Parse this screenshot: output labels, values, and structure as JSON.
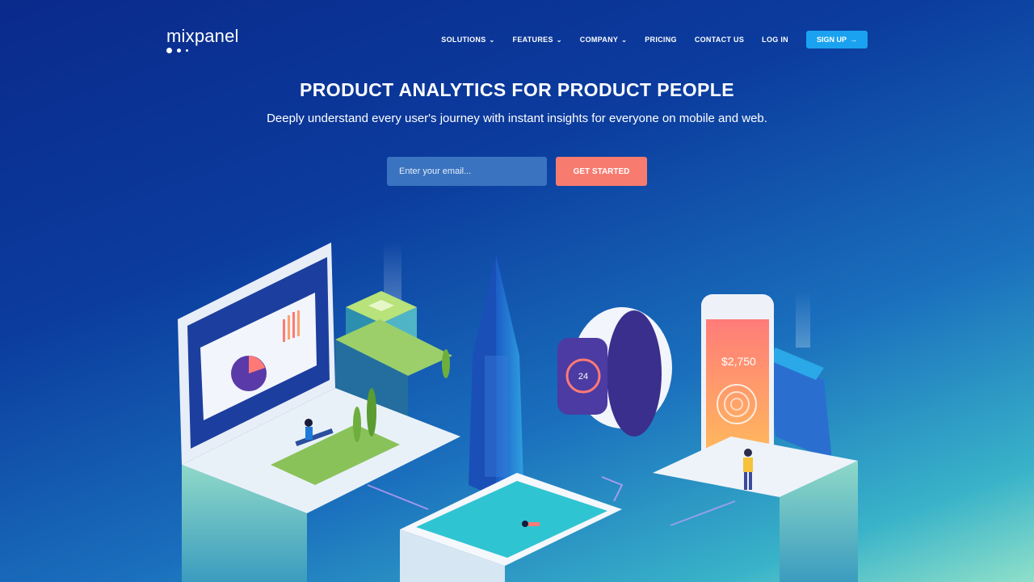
{
  "brand": {
    "name": "mixpanel"
  },
  "nav": {
    "items": [
      {
        "label": "SOLUTIONS",
        "has_dropdown": true
      },
      {
        "label": "FEATURES",
        "has_dropdown": true
      },
      {
        "label": "COMPANY",
        "has_dropdown": true
      },
      {
        "label": "PRICING",
        "has_dropdown": false
      },
      {
        "label": "CONTACT US",
        "has_dropdown": false
      },
      {
        "label": "LOG IN",
        "has_dropdown": false
      }
    ],
    "signup_label": "SIGN UP",
    "signup_arrow": "→"
  },
  "hero": {
    "title": "PRODUCT ANALYTICS FOR PRODUCT PEOPLE",
    "subtitle": "Deeply understand every user's journey with instant insights for everyone on mobile and web.",
    "email_placeholder": "Enter your email...",
    "email_value": "",
    "cta_label": "GET STARTED"
  },
  "illustration": {
    "watch_value": "24",
    "phone_amount": "$2,750"
  },
  "colors": {
    "background_top": "#0a2a8c",
    "background_bottom": "#8fe0c9",
    "signup_button": "#1aa2f0",
    "cta_button": "#f77b6f",
    "email_input": "#3a73bf"
  },
  "icons": [
    "chevron-down-icon",
    "arrow-right-icon"
  ]
}
